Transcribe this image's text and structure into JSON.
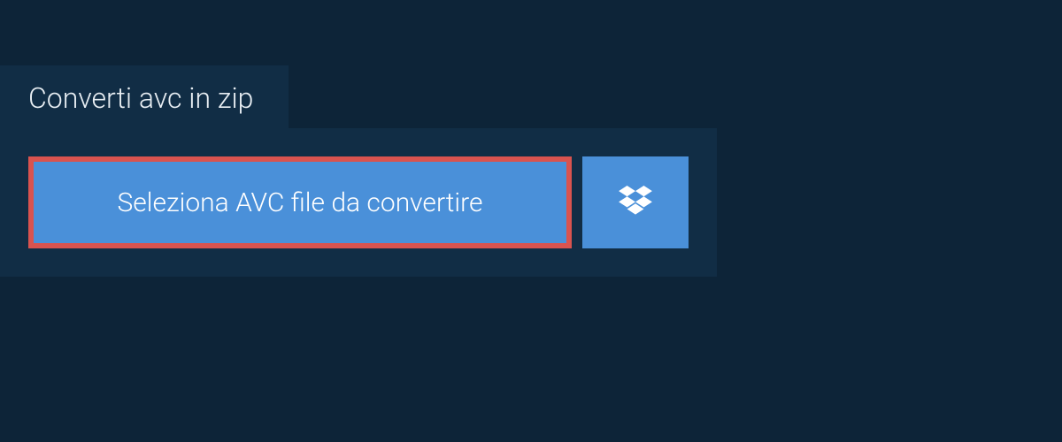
{
  "tab": {
    "title": "Converti avc in zip"
  },
  "actions": {
    "select_file_label": "Seleziona AVC file da convertire"
  },
  "colors": {
    "background": "#0d2438",
    "panel": "#112d45",
    "button": "#4a90d9",
    "highlight_border": "#d9534f",
    "text_light": "#ffffff"
  }
}
